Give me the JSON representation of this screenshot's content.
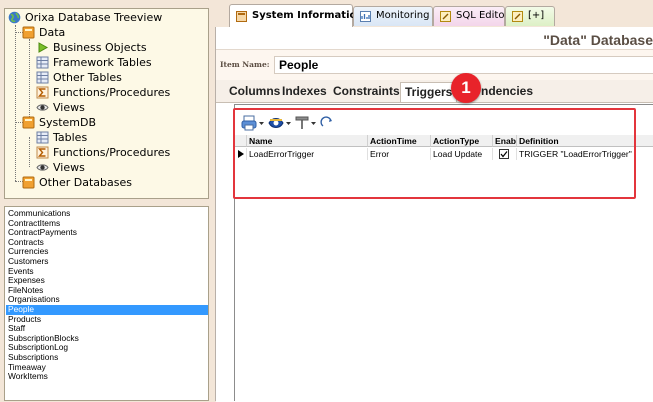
{
  "tree": {
    "root_label": "Orixa Database Treeview",
    "data_label": "Data",
    "data_children": [
      "Business Objects",
      "Framework Tables",
      "Other Tables",
      "Functions/Procedures",
      "Views"
    ],
    "systemdb_label": "SystemDB",
    "systemdb_children": [
      "Tables",
      "Functions/Procedures",
      "Views"
    ],
    "other_label": "Other Databases"
  },
  "list": {
    "items": [
      "Communications",
      "ContractItems",
      "ContractPayments",
      "Contracts",
      "Currencies",
      "Customers",
      "Events",
      "Expenses",
      "FileNotes",
      "Organisations",
      "People",
      "Products",
      "Staff",
      "SubscriptionBlocks",
      "SubscriptionLog",
      "Subscriptions",
      "Timeaway",
      "WorkItems"
    ],
    "selected": "People"
  },
  "top_tabs": {
    "system_info": "System Information",
    "monitoring": "Monitoring",
    "sql_editor": "SQL Editor",
    "new_tab": "[+]"
  },
  "db_title": "\"Data\" Database",
  "item_name": {
    "label": "Item Name:",
    "value": "People"
  },
  "sub_tabs": {
    "columns": "Columns",
    "indexes": "Indexes",
    "constraints": "Constraints",
    "triggers": "Triggers",
    "dependencies_visible": "ndencies"
  },
  "grid": {
    "headers": [
      "Name",
      "ActionTime",
      "ActionType",
      "Enab",
      "Definition"
    ],
    "rows": [
      {
        "name": "LoadErrorTrigger",
        "action_time": "Error",
        "action_type": "Load Update",
        "enabled": true,
        "definition": "TRIGGER \"LoadErrorTrigger\""
      }
    ]
  },
  "annotation": {
    "badge": "1",
    "color": "#e3353c"
  },
  "colors": {
    "selection": "#3399ff",
    "tree_bg": "#fdf9e6",
    "app_bg": "#f3e6d8"
  },
  "icons": [
    "globe-icon",
    "database-icon",
    "arrow-right-icon",
    "table-icon",
    "sigma-icon",
    "eye-icon",
    "printer-icon",
    "chevron-down-icon",
    "pin-icon",
    "refresh-icon"
  ]
}
